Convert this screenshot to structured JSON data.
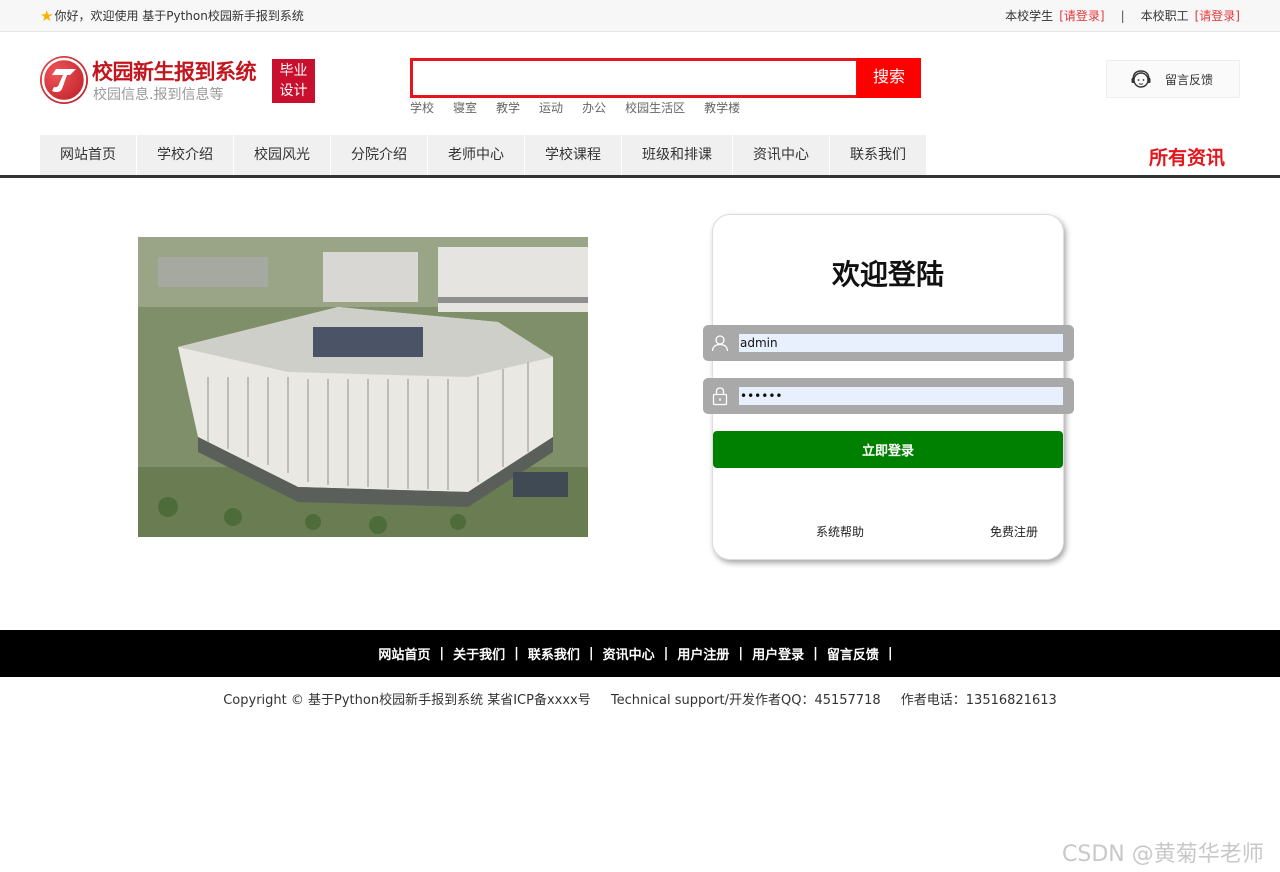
{
  "topbar": {
    "welcome": "你好，欢迎使用 基于Python校园新手报到系统",
    "student_label": "本校学生",
    "student_login": "[请登录]",
    "separator": "|",
    "staff_label": "本校职工",
    "staff_login": "[请登录]"
  },
  "logo": {
    "title": "校园新生报到系统",
    "subtitle": "校园信息.报到信息等",
    "badge_line1": "毕业",
    "badge_line2": "设计"
  },
  "search": {
    "value": "",
    "button": "搜索",
    "hot_keywords": [
      "学校",
      "寝室",
      "教学",
      "运动",
      "办公",
      "校园生活区",
      "教学楼"
    ]
  },
  "feedback": {
    "label": "留言反馈",
    "icon": "customer-service-icon"
  },
  "nav": {
    "items": [
      "网站首页",
      "学校介绍",
      "校园风光",
      "分院介绍",
      "老师中心",
      "学校课程",
      "班级和排课",
      "资讯中心",
      "联系我们"
    ],
    "all_news": "所有资讯"
  },
  "login": {
    "title": "欢迎登陆",
    "username": "admin",
    "password": "••••••",
    "submit": "立即登录",
    "help": "系统帮助",
    "register": "免费注册"
  },
  "footer": {
    "links": [
      "网站首页",
      "关于我们",
      "联系我们",
      "资讯中心",
      "用户注册",
      "用户登录",
      "留言反馈"
    ],
    "separator": "|",
    "copyright": "Copyright © 基于Python校园新手报到系统 某省ICP备xxxx号",
    "support": "Technical support/开发作者QQ：45157718",
    "phone": "作者电话：13516821613"
  },
  "watermark": "CSDN @黄菊华老师",
  "colors": {
    "brand_red": "#e4161c",
    "login_green": "#008000",
    "footer_black": "#000000"
  }
}
